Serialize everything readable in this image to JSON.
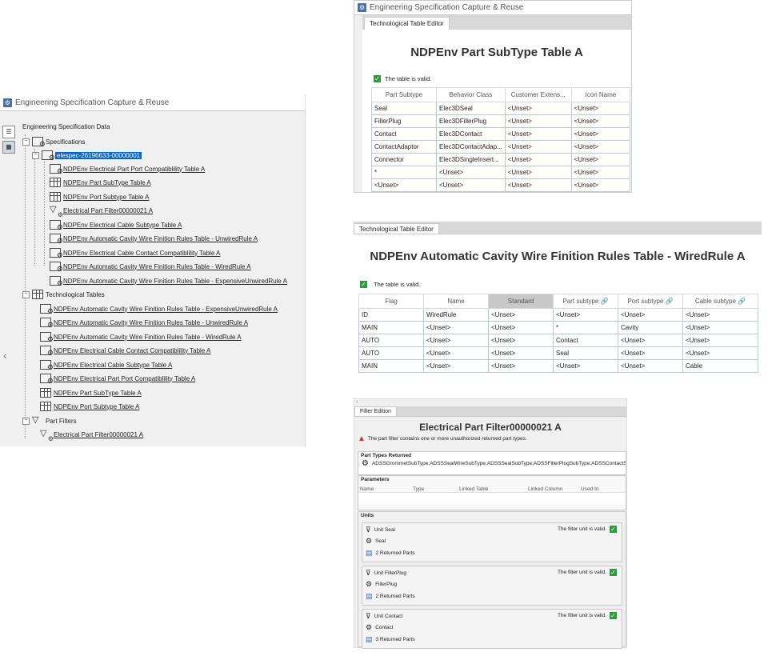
{
  "left_panel": {
    "title": "Engineering Specification Capture & Reuse",
    "root": "Engineering Specification Data",
    "specifications_label": "Specifications",
    "spec_id": "elespec-26196633-00000001",
    "spec_children": [
      "NDPEnv Electrical Part Port Compatiblility Table A",
      "NDPEnv Part SubType Table A",
      "NDPEnv Port Subtype Table A",
      "Electrical Part Filter00000021 A",
      "NDPEnv Electrical Cable Subtype Table A",
      "NDPEnv Automatic Cavity Wire Finition Rules Table - UnwiredRule A",
      "NDPEnv Electrical Cable Contact Compatiblility Table A",
      "NDPEnv Automatic Cavity Wire Finition Rules Table - WiredRule A",
      "NDPEnv Automatic Cavity Wire Finition Rules Table - ExpensiveUnwiredRule A"
    ],
    "tech_tables_label": "Technological Tables",
    "tech_children": [
      "NDPEnv Automatic Cavity Wire Finition Rules Table - ExpensiveUnwiredRule A",
      "NDPEnv Automatic Cavity Wire Finition Rules Table - UnwiredRule A",
      "NDPEnv Automatic Cavity Wire Finition Rules Table - WiredRule A",
      "NDPEnv Electrical Cable Contact Compatiblility Table A",
      "NDPEnv Electrical Cable Subtype Table A",
      "NDPEnv Electrical Part Port Compatiblility Table A",
      "NDPEnv Part SubType Table A",
      "NDPEnv Port Subtype Table A"
    ],
    "part_filters_label": "Part Filters",
    "filter_child": "Electrical Part Filter00000021 A"
  },
  "subtype_panel": {
    "title": "Engineering Specification Capture & Reuse",
    "tab": "Technological Table Editor",
    "heading": "NDPEnv Part SubType Table A",
    "valid_text": "The table is valid.",
    "columns": [
      "Part Subtype",
      "Behavior Class",
      "Customer Extens...",
      "Icon Name"
    ],
    "rows": [
      [
        "Seal",
        "Elec3DSeal",
        "<Unset>",
        "<Unset>"
      ],
      [
        "FillerPlug",
        "Elec3DFillerPlug",
        "<Unset>",
        "<Unset>"
      ],
      [
        "Contact",
        "Elec3DContact",
        "<Unset>",
        "<Unset>"
      ],
      [
        "ContactAdaptor",
        "Elec3DContactAdap...",
        "<Unset>",
        "<Unset>"
      ],
      [
        "Connector",
        "Elec3DSingleInsert...",
        "<Unset>",
        "<Unset>"
      ],
      [
        "*",
        "<Unset>",
        "<Unset>",
        "<Unset>"
      ],
      [
        "<Unset>",
        "<Unset>",
        "<Unset>",
        "<Unset>"
      ]
    ]
  },
  "wired_panel": {
    "tab": "Technological Table Editor",
    "heading": "NDPEnv Automatic Cavity Wire Finition Rules Table - WiredRule A",
    "valid_text": "The table is valid.",
    "columns": [
      "Flag",
      "Name",
      "Standard",
      "Part subtype",
      "Port subtype",
      "Cable subtype"
    ],
    "rows": [
      [
        "ID",
        "WiredRule",
        "<Unset>",
        "<Unset>",
        "<Unset>",
        "<Unset>"
      ],
      [
        "MAIN",
        "<Unset>",
        "<Unset>",
        "*",
        "Cavity",
        "<Unset>"
      ],
      [
        "AUTO",
        "<Unset>",
        "<Unset>",
        "Contact",
        "<Unset>",
        "<Unset>"
      ],
      [
        "AUTO",
        "<Unset>",
        "<Unset>",
        "Seal",
        "<Unset>",
        "<Unset>"
      ],
      [
        "MAIN",
        "<Unset>",
        "<Unset>",
        "<Unset>",
        "<Unset>",
        "Cable"
      ]
    ]
  },
  "filter_panel": {
    "tab": "Filter Edition",
    "heading": "Electrical Part Filter00000021 A",
    "warning": "The part filter contains one or more unauthorized returned part types.",
    "part_types_label": "Part Types Returned",
    "part_types_value": "ADSSGrommetSubType;ADSSSealWireSubType;ADSSSealSubType;ADSSFillerPlugSubType;ADSSContactSu",
    "parameters_label": "Parameters",
    "param_columns": [
      "Name",
      "Type",
      "Linked Table",
      "Linked Column",
      "Used In"
    ],
    "units_label": "Units",
    "units": [
      {
        "name": "Unit Seal",
        "valid": "The filter unit is valid.",
        "type": "Seal",
        "returned": "2 Returned Parts"
      },
      {
        "name": "Unit FillerPlug",
        "valid": "The filter unit is valid.",
        "type": "FillerPlug",
        "returned": "2 Returned Parts"
      },
      {
        "name": "Unit Contact",
        "valid": "The filter unit is valid.",
        "type": "Contact",
        "returned": "3 Returned Parts"
      }
    ]
  },
  "colors": {
    "selection": "#0a64c8",
    "valid_check": "#2e9a3c",
    "header_gray": "#c8c8c8"
  }
}
